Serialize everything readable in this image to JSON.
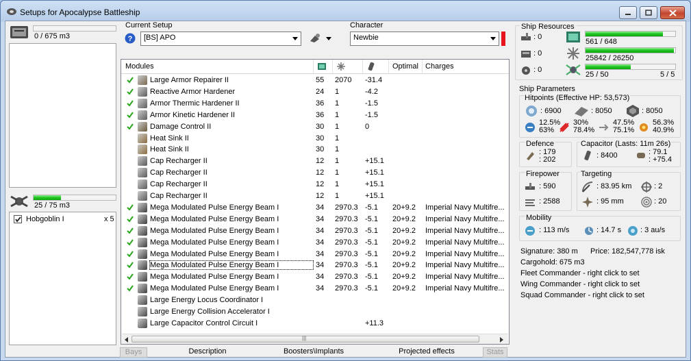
{
  "window": {
    "title": "Setups for Apocalypse Battleship"
  },
  "left": {
    "cargo_text": "0 / 675 m3",
    "cargo_fill": 0.0,
    "drone_text": "25 / 75 m3",
    "drone_fill": 0.333,
    "drones": [
      {
        "name": "Hobgoblin I",
        "qty": "x 5",
        "checked": true
      }
    ]
  },
  "setup": {
    "label": "Current Setup",
    "value": "[BS] APO"
  },
  "character": {
    "label": "Character",
    "value": "Newbie"
  },
  "modules": {
    "headers": [
      "Modules",
      "",
      "",
      "",
      "Optimal",
      "Charges"
    ],
    "rows": [
      {
        "active": true,
        "name": "Large Armor Repairer II",
        "cpu": "55",
        "pg": "2070",
        "cap": "-31.4",
        "optimal": "",
        "charges": "",
        "icon": "armor-repairer-icon"
      },
      {
        "active": true,
        "name": "Reactive Armor Hardener",
        "cpu": "24",
        "pg": "1",
        "cap": "-4.2",
        "optimal": "",
        "charges": "",
        "icon": "armor-hardener-icon"
      },
      {
        "active": true,
        "name": "Armor Thermic Hardener II",
        "cpu": "36",
        "pg": "1",
        "cap": "-1.5",
        "optimal": "",
        "charges": "",
        "icon": "armor-hardener-icon"
      },
      {
        "active": true,
        "name": "Armor Kinetic Hardener II",
        "cpu": "36",
        "pg": "1",
        "cap": "-1.5",
        "optimal": "",
        "charges": "",
        "icon": "armor-hardener-icon"
      },
      {
        "active": true,
        "name": "Damage Control II",
        "cpu": "30",
        "pg": "1",
        "cap": "0",
        "optimal": "",
        "charges": "",
        "icon": "damage-control-icon"
      },
      {
        "active": false,
        "name": "Heat Sink II",
        "cpu": "30",
        "pg": "1",
        "cap": "",
        "optimal": "",
        "charges": "",
        "icon": "heat-sink-icon"
      },
      {
        "active": false,
        "name": "Heat Sink II",
        "cpu": "30",
        "pg": "1",
        "cap": "",
        "optimal": "",
        "charges": "",
        "icon": "heat-sink-icon"
      },
      {
        "active": false,
        "name": "Cap Recharger II",
        "cpu": "12",
        "pg": "1",
        "cap": "+15.1",
        "optimal": "",
        "charges": "",
        "icon": "cap-recharger-icon"
      },
      {
        "active": false,
        "name": "Cap Recharger II",
        "cpu": "12",
        "pg": "1",
        "cap": "+15.1",
        "optimal": "",
        "charges": "",
        "icon": "cap-recharger-icon"
      },
      {
        "active": false,
        "name": "Cap Recharger II",
        "cpu": "12",
        "pg": "1",
        "cap": "+15.1",
        "optimal": "",
        "charges": "",
        "icon": "cap-recharger-icon"
      },
      {
        "active": false,
        "name": "Cap Recharger II",
        "cpu": "12",
        "pg": "1",
        "cap": "+15.1",
        "optimal": "",
        "charges": "",
        "icon": "cap-recharger-icon"
      },
      {
        "active": true,
        "name": "Mega Modulated Pulse Energy Beam I",
        "cpu": "34",
        "pg": "2970.3",
        "cap": "-5.1",
        "optimal": "20+9.2",
        "charges": "Imperial Navy Multifre...",
        "icon": "laser-icon"
      },
      {
        "active": true,
        "name": "Mega Modulated Pulse Energy Beam I",
        "cpu": "34",
        "pg": "2970.3",
        "cap": "-5.1",
        "optimal": "20+9.2",
        "charges": "Imperial Navy Multifre...",
        "icon": "laser-icon"
      },
      {
        "active": true,
        "name": "Mega Modulated Pulse Energy Beam I",
        "cpu": "34",
        "pg": "2970.3",
        "cap": "-5.1",
        "optimal": "20+9.2",
        "charges": "Imperial Navy Multifre...",
        "icon": "laser-icon"
      },
      {
        "active": true,
        "name": "Mega Modulated Pulse Energy Beam I",
        "cpu": "34",
        "pg": "2970.3",
        "cap": "-5.1",
        "optimal": "20+9.2",
        "charges": "Imperial Navy Multifre...",
        "icon": "laser-icon"
      },
      {
        "active": true,
        "name": "Mega Modulated Pulse Energy Beam I",
        "cpu": "34",
        "pg": "2970.3",
        "cap": "-5.1",
        "optimal": "20+9.2",
        "charges": "Imperial Navy Multifre...",
        "icon": "laser-icon"
      },
      {
        "active": true,
        "name": "Mega Modulated Pulse Energy Beam I",
        "cpu": "34",
        "pg": "2970.3",
        "cap": "-5.1",
        "optimal": "20+9.2",
        "charges": "Imperial Navy Multifre...",
        "icon": "laser-icon",
        "focused": true
      },
      {
        "active": true,
        "name": "Mega Modulated Pulse Energy Beam I",
        "cpu": "34",
        "pg": "2970.3",
        "cap": "-5.1",
        "optimal": "20+9.2",
        "charges": "Imperial Navy Multifre...",
        "icon": "laser-icon"
      },
      {
        "active": true,
        "name": "Mega Modulated Pulse Energy Beam I",
        "cpu": "34",
        "pg": "2970.3",
        "cap": "-5.1",
        "optimal": "20+9.2",
        "charges": "Imperial Navy Multifre...",
        "icon": "laser-icon"
      },
      {
        "active": false,
        "name": "Large Energy Locus Coordinator I",
        "cpu": "",
        "pg": "",
        "cap": "",
        "optimal": "",
        "charges": "",
        "icon": "rig-icon"
      },
      {
        "active": false,
        "name": "Large Energy Collision Accelerator I",
        "cpu": "",
        "pg": "",
        "cap": "",
        "optimal": "",
        "charges": "",
        "icon": "rig-icon"
      },
      {
        "active": false,
        "name": "Large Capacitor Control Circuit I",
        "cpu": "",
        "pg": "",
        "cap": "+11.3",
        "optimal": "",
        "charges": "",
        "icon": "rig-icon"
      }
    ]
  },
  "tabs": [
    "Bays",
    "Description",
    "Boosters\\Implants",
    "Projected effects",
    "Stats"
  ],
  "resources": {
    "label": "Ship Resources",
    "turret": ": 0",
    "launcher": ": 0",
    "calibration": ": 0",
    "cpu_text": "561 / 648",
    "cpu_fill": 0.866,
    "pg_text": "25842 / 26250",
    "pg_fill": 0.984,
    "drone_bw_text": "25 / 50",
    "drone_bw_fill": 0.5,
    "drones_active": "5 / 5"
  },
  "params": {
    "label": "Ship Parameters",
    "hitpoints_label": "Hitpoints (Effective HP: 53,573)",
    "shield_hp": ": 6900",
    "armor_hp": ": 8050",
    "hull_hp": ": 8050",
    "shield_res": [
      "12.5%",
      "63%"
    ],
    "armor_res": [
      "30%",
      "78.4%"
    ],
    "hull_res": [
      "47.5%",
      "75.1%"
    ],
    "other_res": [
      "56.3%",
      "40.9%"
    ],
    "defence_label": "Defence",
    "def1": ": 179",
    "def2": ": 202",
    "capacitor_label": "Capacitor (Lasts: 11m 26s)",
    "cap_amount": ": 8400",
    "cap1": ": 79.1",
    "cap2": ": +75.4",
    "firepower_label": "Firepower",
    "fp1": ": 590",
    "fp2": ": 2588",
    "targeting_label": "Targeting",
    "range": ": 83.95 km",
    "max_targets": ": 2",
    "scan_res": ": 95 mm",
    "sensor": ": 20",
    "mobility_label": "Mobility",
    "speed": ": 113 m/s",
    "align": ": 14.7 s",
    "warp": ": 3 au/s",
    "signature": "Signature: 380 m",
    "price": "Price: 182,547,778 isk",
    "cargohold": "Cargohold: 675 m3",
    "fleet": "Fleet Commander - right click to set",
    "wing": "Wing Commander - right click to set",
    "squad": "Squad Commander - right click to set"
  },
  "colors": {
    "bar_green": "#1ec31e",
    "accent_red": "#e8141d",
    "check_green": "#2aa61c"
  }
}
